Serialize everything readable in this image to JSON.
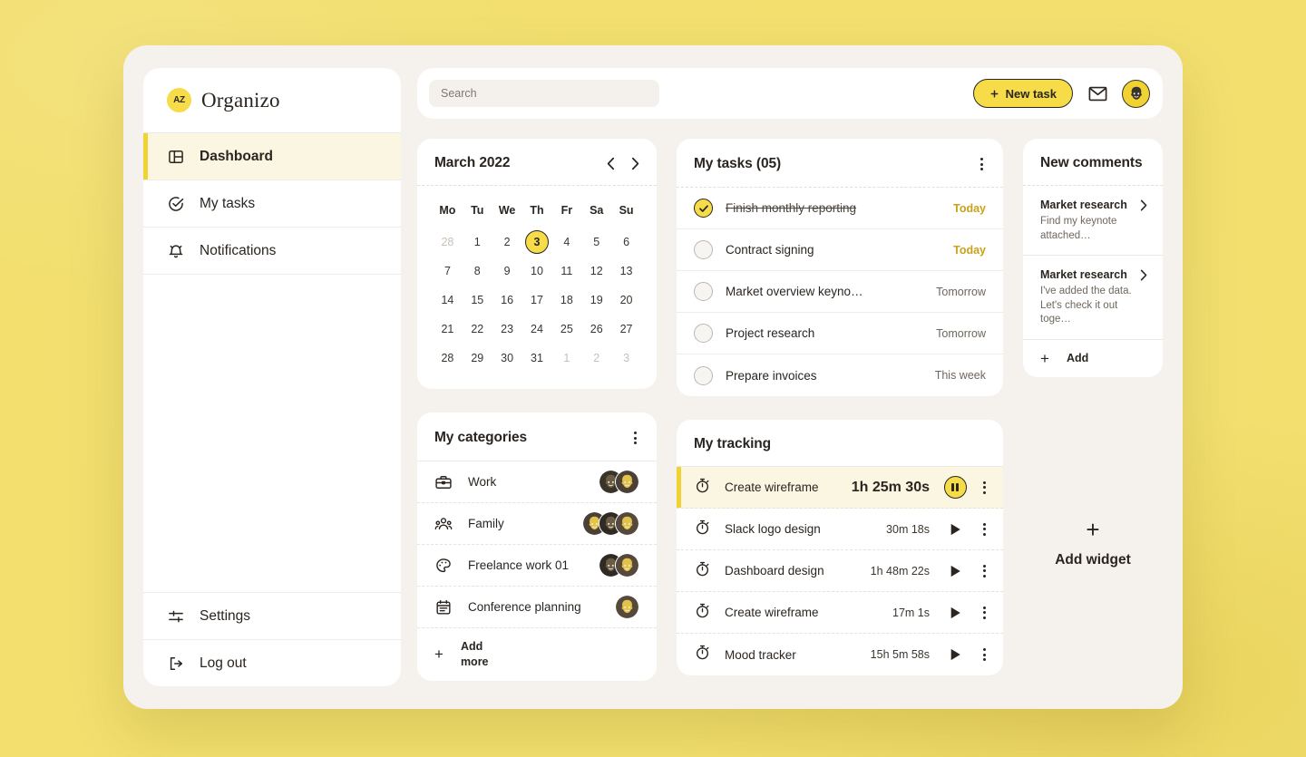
{
  "brand": {
    "logo_text": "AZ",
    "name": "Organizo"
  },
  "sidebar": {
    "items": [
      {
        "label": "Dashboard",
        "icon": "layout-icon"
      },
      {
        "label": "My tasks",
        "icon": "check-circle-icon"
      },
      {
        "label": "Notifications",
        "icon": "bell-icon"
      }
    ],
    "bottom": [
      {
        "label": "Settings",
        "icon": "sliders-icon"
      },
      {
        "label": "Log out",
        "icon": "logout-icon"
      }
    ]
  },
  "topbar": {
    "search_placeholder": "Search",
    "search_value": "",
    "new_task_label": "New task",
    "mail_icon": "envelope-icon",
    "avatar": "user-avatar"
  },
  "calendar": {
    "title": "March 2022",
    "prev_icon": "chevron-left-icon",
    "next_icon": "chevron-right-icon",
    "dow": [
      "Mo",
      "Tu",
      "We",
      "Th",
      "Fr",
      "Sa",
      "Su"
    ],
    "weeks": [
      [
        {
          "d": "28",
          "m": true
        },
        {
          "d": "1"
        },
        {
          "d": "2"
        },
        {
          "d": "3",
          "today": true
        },
        {
          "d": "4"
        },
        {
          "d": "5"
        },
        {
          "d": "6"
        }
      ],
      [
        {
          "d": "7"
        },
        {
          "d": "8"
        },
        {
          "d": "9"
        },
        {
          "d": "10"
        },
        {
          "d": "11"
        },
        {
          "d": "12"
        },
        {
          "d": "13"
        }
      ],
      [
        {
          "d": "14"
        },
        {
          "d": "15"
        },
        {
          "d": "16"
        },
        {
          "d": "17"
        },
        {
          "d": "18"
        },
        {
          "d": "19"
        },
        {
          "d": "20"
        }
      ],
      [
        {
          "d": "21"
        },
        {
          "d": "22"
        },
        {
          "d": "23"
        },
        {
          "d": "24"
        },
        {
          "d": "25"
        },
        {
          "d": "26"
        },
        {
          "d": "27"
        }
      ],
      [
        {
          "d": "28"
        },
        {
          "d": "29"
        },
        {
          "d": "30"
        },
        {
          "d": "31"
        },
        {
          "d": "1",
          "m": true
        },
        {
          "d": "2",
          "m": true
        },
        {
          "d": "3",
          "m": true
        }
      ]
    ]
  },
  "tasks": {
    "title": "My tasks (05)",
    "menu_icon": "kebab-menu-icon",
    "items": [
      {
        "name": "Finish monthly reporting",
        "due": "Today",
        "done": true,
        "accent": true
      },
      {
        "name": "Contract signing",
        "due": "Today",
        "done": false,
        "accent": true
      },
      {
        "name": "Market overview keyno…",
        "due": "Tomorrow",
        "done": false,
        "accent": false
      },
      {
        "name": "Project research",
        "due": "Tomorrow",
        "done": false,
        "accent": false
      },
      {
        "name": "Prepare invoices",
        "due": "This week",
        "done": false,
        "accent": false
      }
    ]
  },
  "categories": {
    "title": "My categories",
    "menu_icon": "kebab-menu-icon",
    "items": [
      {
        "name": "Work",
        "icon": "briefcase-icon",
        "avatars": 2
      },
      {
        "name": "Family",
        "icon": "people-icon",
        "avatars": 3
      },
      {
        "name": "Freelance work 01",
        "icon": "palette-icon",
        "avatars": 2
      },
      {
        "name": "Conference planning",
        "icon": "calendar-icon",
        "avatars": 1
      }
    ],
    "add_label_line1": "Add",
    "add_label_line2": "more"
  },
  "tracking": {
    "title": "My tracking",
    "items": [
      {
        "name": "Create wireframe",
        "time": "1h 25m 30s",
        "active": true,
        "control": "pause-icon"
      },
      {
        "name": "Slack logo design",
        "time": "30m 18s",
        "active": false,
        "control": "play-icon"
      },
      {
        "name": "Dashboard design",
        "time": "1h 48m 22s",
        "active": false,
        "control": "play-icon"
      },
      {
        "name": "Create wireframe",
        "time": "17m 1s",
        "active": false,
        "control": "play-icon"
      },
      {
        "name": "Mood tracker",
        "time": "15h 5m 58s",
        "active": false,
        "control": "play-icon"
      }
    ]
  },
  "comments": {
    "title": "New comments",
    "items": [
      {
        "title": "Market research",
        "line1": "Find my keynote",
        "line2": "attached…"
      },
      {
        "title": "Market research",
        "line1": "I've added the data.",
        "line2": "Let's check it out toge…"
      }
    ],
    "add_label": "Add"
  },
  "add_widget": {
    "label": "Add widget",
    "plus": "+"
  },
  "colors": {
    "accent": "#F5DC48",
    "accent_dark": "#F0D232",
    "page_bg": "#F2DF6E",
    "app_bg": "#F5F1ED",
    "ink": "#2A2520",
    "due_accent": "#C9A21A"
  }
}
